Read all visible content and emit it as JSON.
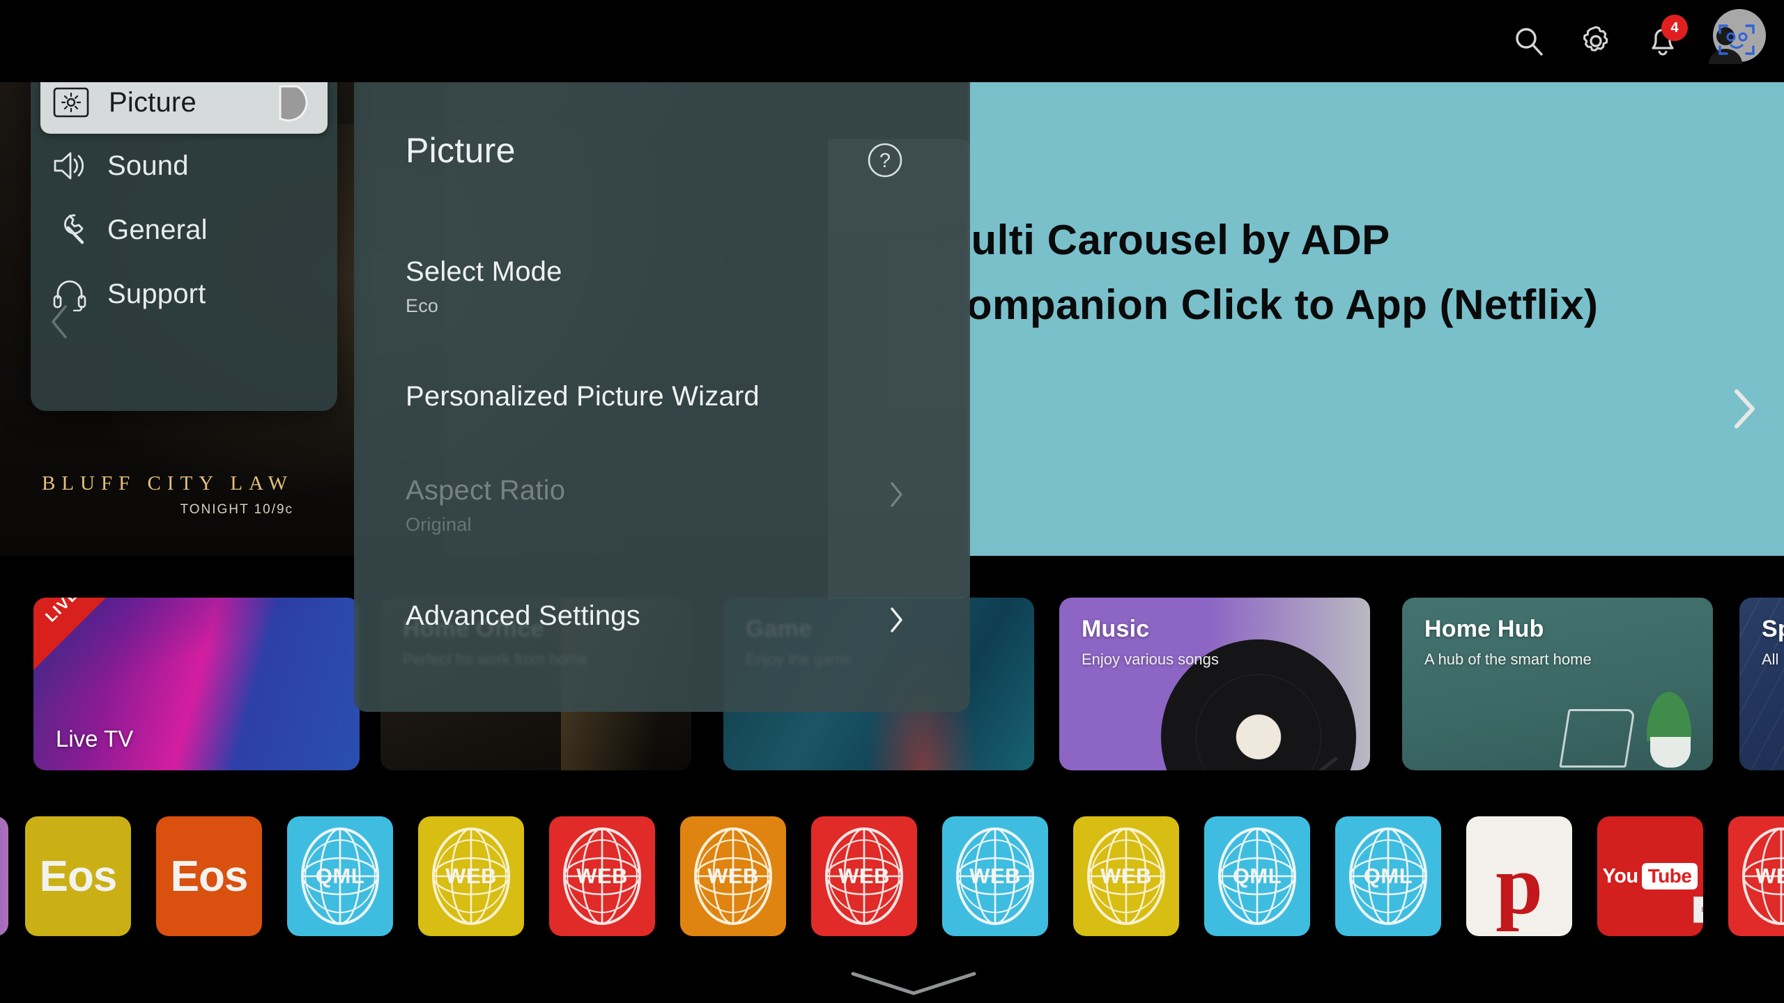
{
  "topbar": {
    "icons": [
      {
        "name": "search-icon",
        "label": "Search"
      },
      {
        "name": "gear-icon",
        "label": "Settings"
      },
      {
        "name": "bell-icon",
        "label": "Notifications",
        "badge": "4"
      },
      {
        "name": "avatar-icon",
        "label": "Account"
      }
    ]
  },
  "hero": {
    "line1": "Multi  Carousel by ADP",
    "line2": "Companion Click to  App (Netflix)",
    "next_arrow": "chevron-right-icon",
    "promo": {
      "title": "BLUFF CITY LAW",
      "subtitle": "TONIGHT 10/9c"
    }
  },
  "settings": {
    "sidebar": {
      "items": [
        {
          "label": "Picture",
          "icon": "brightness-icon",
          "selected": true
        },
        {
          "label": "Sound",
          "icon": "speaker-icon",
          "selected": false
        },
        {
          "label": "General",
          "icon": "wrench-icon",
          "selected": false
        },
        {
          "label": "Support",
          "icon": "headset-icon",
          "selected": false
        }
      ],
      "back_chevron": "chevron-left-icon"
    },
    "panel": {
      "title": "Picture",
      "help_icon": "help-circle-icon",
      "rows": [
        {
          "label": "Select Mode",
          "value": "Eco",
          "chevron": false,
          "disabled": false
        },
        {
          "label": "Personalized Picture Wizard",
          "value": "",
          "chevron": false,
          "disabled": false
        },
        {
          "label": "Aspect Ratio",
          "value": "Original",
          "chevron": true,
          "disabled": true
        },
        {
          "label": "Advanced Settings",
          "value": "",
          "chevron": true,
          "disabled": false
        }
      ]
    }
  },
  "cards": [
    {
      "name": "live-tv",
      "badge": "LIVE",
      "bottom_label": "Live TV",
      "title": "",
      "subtitle": ""
    },
    {
      "name": "home-office",
      "badge": "",
      "bottom_label": "",
      "title": "Home Office",
      "subtitle": "Perfect for work from home"
    },
    {
      "name": "game",
      "badge": "",
      "bottom_label": "",
      "title": "Game",
      "subtitle": "Enjoy the game"
    },
    {
      "name": "music",
      "badge": "",
      "bottom_label": "",
      "title": "Music",
      "subtitle": "Enjoy various songs"
    },
    {
      "name": "home-hub",
      "badge": "",
      "bottom_label": "",
      "title": "Home Hub",
      "subtitle": "A hub of the smart home"
    },
    {
      "name": "sports",
      "badge": "",
      "bottom_label": "",
      "title": "Sp",
      "subtitle": "All"
    }
  ],
  "dock": {
    "apps": [
      {
        "name": "eos-yellow",
        "label": "Eos",
        "kind": "text",
        "bg": "#cbb015",
        "fg": "#f2f2ee"
      },
      {
        "name": "eos-orange",
        "label": "Eos",
        "kind": "text",
        "bg": "#d9500f",
        "fg": "#f2f2ee"
      },
      {
        "name": "qml-cyan-1",
        "label": "QML",
        "kind": "globe",
        "bg": "#3fbde0",
        "fg": "#f4f4ef"
      },
      {
        "name": "web-yellow-1",
        "label": "WEB",
        "kind": "globe",
        "bg": "#d8bd12",
        "fg": "#f4f4ef"
      },
      {
        "name": "web-red-1",
        "label": "WEB",
        "kind": "globe",
        "bg": "#e02b28",
        "fg": "#f4f4ef"
      },
      {
        "name": "web-orange",
        "label": "WEB",
        "kind": "globe",
        "bg": "#df8410",
        "fg": "#f4f4ef"
      },
      {
        "name": "web-red-2",
        "label": "WEB",
        "kind": "globe",
        "bg": "#e02b28",
        "fg": "#f4f4ef"
      },
      {
        "name": "web-cyan",
        "label": "WEB",
        "kind": "globe",
        "bg": "#3fbde0",
        "fg": "#f4f4ef"
      },
      {
        "name": "web-yellow-2",
        "label": "WEB",
        "kind": "globe",
        "bg": "#d8bd12",
        "fg": "#f4f4ef"
      },
      {
        "name": "qml-cyan-2",
        "label": "QML",
        "kind": "globe",
        "bg": "#3fbde0",
        "fg": "#f4f4ef"
      },
      {
        "name": "qml-cyan-3",
        "label": "QML",
        "kind": "globe",
        "bg": "#3fbde0",
        "fg": "#f4f4ef"
      },
      {
        "name": "pandora",
        "label": "p",
        "kind": "pandora",
        "bg": "#f3f0eb",
        "fg": "#c2181b"
      },
      {
        "name": "youtube",
        "label": "You Tube",
        "kind": "youtube",
        "bg": "#d41f1f",
        "fg": "#ffffff"
      },
      {
        "name": "web-red-3",
        "label": "WEB",
        "kind": "globe",
        "bg": "#e02b28",
        "fg": "#f4f4ef"
      }
    ],
    "handle_icon": "chevron-down-icon"
  },
  "colors": {
    "panel_bg": "#394a4c",
    "sidebar_bg": "#2e3e40",
    "selected_bg": "#d6dadb",
    "hero_teal": "#79c0cb",
    "badge_red": "#e02020",
    "text_primary": "#eef2f3"
  }
}
